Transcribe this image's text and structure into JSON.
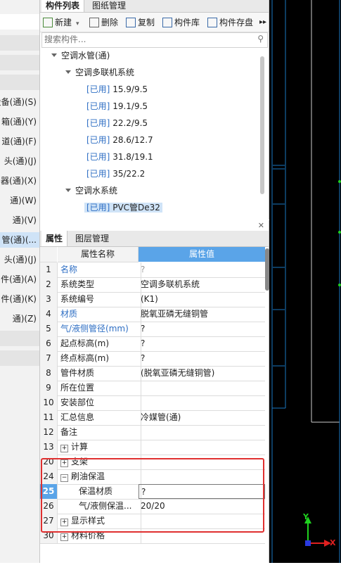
{
  "left_panel": {
    "items": [
      "设备(通)(S)",
      "箱(通)(Y)",
      "道(通)(F)",
      "头(通)(J)",
      "器(通)(X)",
      "通)(W)",
      "通)(V)",
      "管(通)(...",
      "头(通)(J)",
      "件(通)(A)",
      "件(通)(K)",
      "通)(Z)"
    ]
  },
  "component_panel": {
    "tabs": [
      "构件列表",
      "图纸管理"
    ],
    "toolbar": {
      "new_label": "新建",
      "delete_label": "删除",
      "copy_label": "复制",
      "library_label": "构件库",
      "store_label": "构件存盘",
      "more_label": "▸▸"
    },
    "search": {
      "placeholder": "搜索构件..."
    },
    "tree": {
      "root": "空调水管(通)",
      "group1": "空调多联机系统",
      "used_tag": "[已用]",
      "group1_items": [
        "15.9/9.5",
        "19.1/9.5",
        "22.2/9.5",
        "28.6/12.7",
        "31.8/19.1",
        "35/22.2"
      ],
      "group2": "空调水系统",
      "group2_items": [
        "PVC管De32"
      ]
    }
  },
  "property_panel": {
    "tabs": [
      "属性",
      "图层管理"
    ],
    "headers": {
      "name": "属性名称",
      "value": "属性值"
    },
    "rows": [
      {
        "num": "1",
        "name": "名称",
        "value": "?"
      },
      {
        "num": "2",
        "name": "系统类型",
        "value": "空调多联机系统"
      },
      {
        "num": "3",
        "name": "系统编号",
        "value": "(K1)"
      },
      {
        "num": "4",
        "name": "材质",
        "value": "脱氧亚磷无缝铜管"
      },
      {
        "num": "5",
        "name": "气/液侧管径(mm)",
        "value": "?"
      },
      {
        "num": "6",
        "name": "起点标高(m)",
        "value": "?"
      },
      {
        "num": "7",
        "name": "终点标高(m)",
        "value": "?"
      },
      {
        "num": "8",
        "name": "管件材质",
        "value": "(脱氧亚磷无缝铜管)"
      },
      {
        "num": "9",
        "name": "所在位置",
        "value": ""
      },
      {
        "num": "10",
        "name": "安装部位",
        "value": ""
      },
      {
        "num": "11",
        "name": "汇总信息",
        "value": "冷媒管(通)"
      },
      {
        "num": "12",
        "name": "备注",
        "value": ""
      },
      {
        "num": "13",
        "name": "计算",
        "value": ""
      },
      {
        "num": "20",
        "name": "支架",
        "value": ""
      },
      {
        "num": "24",
        "name": "刷油保温",
        "value": ""
      },
      {
        "num": "25",
        "name": "保温材质",
        "value": "?"
      },
      {
        "num": "26",
        "name": "气/液侧保温...",
        "value": "20/20"
      },
      {
        "num": "27",
        "name": "显示样式",
        "value": ""
      },
      {
        "num": "30",
        "name": "材料价格",
        "value": ""
      }
    ]
  },
  "canvas": {
    "axis_y_label": "Y",
    "axis_x_label": "X",
    "colors": {
      "background": "#000000",
      "grid_line": "#1a78c2",
      "axis_y": "#1fd11f",
      "axis_x": "#e02020",
      "highlight_box": "#e03030"
    }
  }
}
